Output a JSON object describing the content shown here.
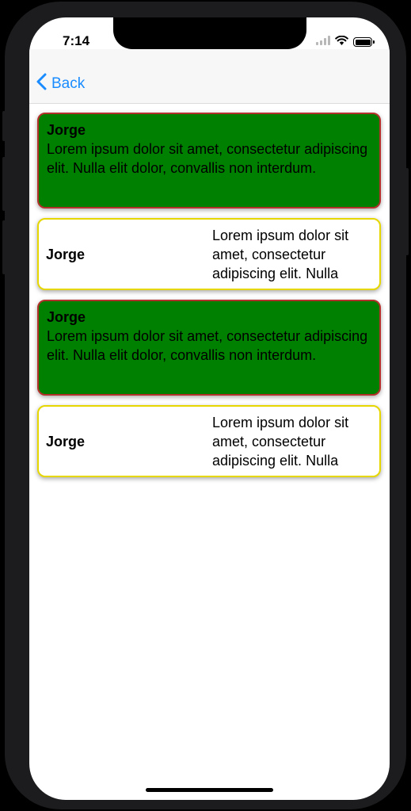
{
  "status_bar": {
    "time": "7:14",
    "icons": [
      "signal-icon",
      "wifi-icon",
      "battery-icon"
    ]
  },
  "nav": {
    "back_label": "Back",
    "back_icon": "chevron-left-icon",
    "accent_color": "#1a8cff"
  },
  "cards": [
    {
      "style": "green",
      "title": "Jorge",
      "text": "Lorem ipsum dolor sit amet, consectetur adipiscing elit. Nulla elit dolor, convallis non interdum."
    },
    {
      "style": "white",
      "title": "Jorge",
      "text": "Lorem ipsum dolor sit amet, consectetur adipiscing elit. Nulla"
    },
    {
      "style": "green",
      "title": "Jorge",
      "text": "Lorem ipsum dolor sit amet, consectetur adipiscing elit. Nulla elit dolor, convallis non interdum."
    },
    {
      "style": "white",
      "title": "Jorge",
      "text": "Lorem ipsum dolor sit amet, consectetur adipiscing elit. Nulla"
    }
  ],
  "colors": {
    "green_card_bg": "#008000",
    "green_card_border": "#b3312b",
    "white_card_border": "#e6d700"
  }
}
